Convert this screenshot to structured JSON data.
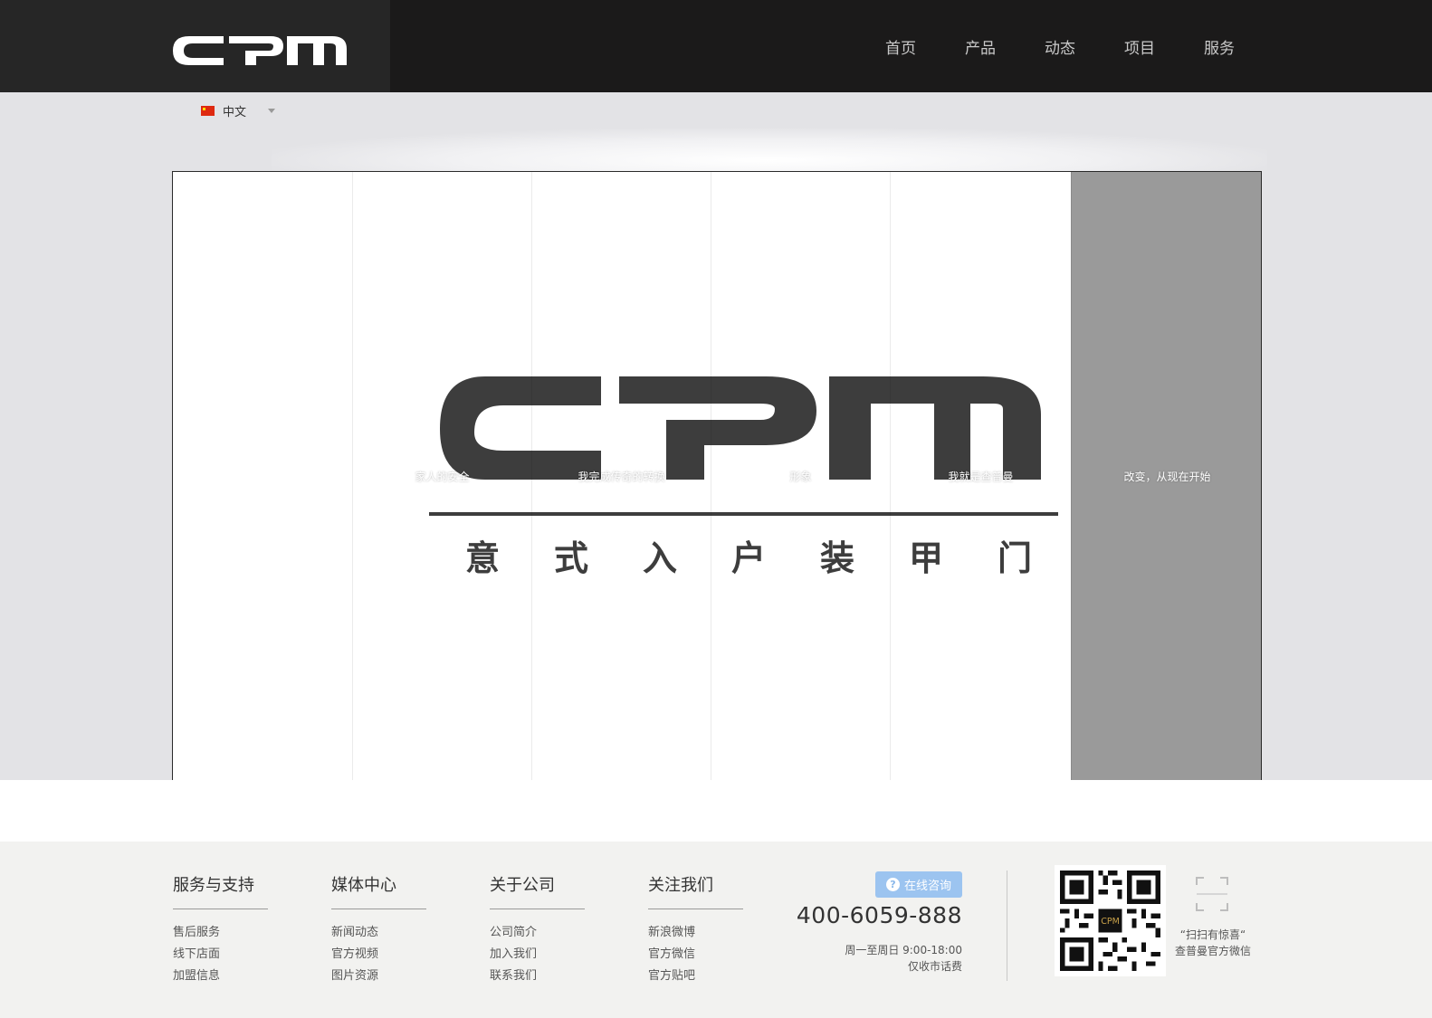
{
  "brand": {
    "logo_text": "CPM",
    "tagline": "意 式 入 户 装 甲 门",
    "accent": "#9cc4f0",
    "dark": "#1b1a1a"
  },
  "nav": [
    "首页",
    "产品",
    "动态",
    "项目",
    "服务"
  ],
  "language": {
    "label": "中文",
    "flag": "cn-flag-icon"
  },
  "slider": {
    "captions": [
      "家人的安全",
      "我完成传奇的转换",
      "形象",
      "我就是查普曼",
      "改变，从现在开始"
    ],
    "active_index": 4
  },
  "footer": {
    "columns": [
      {
        "title": "服务与支持",
        "links": [
          "售后服务",
          "线下店面",
          "加盟信息"
        ]
      },
      {
        "title": "媒体中心",
        "links": [
          "新闻动态",
          "官方视频",
          "图片资源"
        ]
      },
      {
        "title": "关于公司",
        "links": [
          "公司简介",
          "加入我们",
          "联系我们"
        ]
      },
      {
        "title": "关注我们",
        "links": [
          "新浪微博",
          "官方微信",
          "官方贴吧"
        ]
      }
    ],
    "consult_label": "在线咨询",
    "phone": "400-6059-888",
    "hours": "周一至周日 9:00-18:00",
    "fee": "仅收市话费",
    "qr_caption_1": "“扫扫有惊喜“",
    "qr_caption_2": "查普曼官方微信"
  }
}
